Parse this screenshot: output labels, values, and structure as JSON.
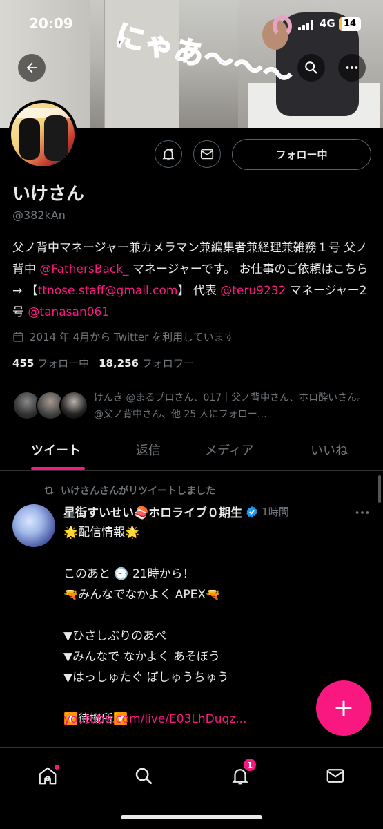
{
  "status_bar": {
    "time": "20:09",
    "network": "4G",
    "battery": "14",
    "battery_level": 0.14
  },
  "banner": {
    "caption": "にゃあ～～～"
  },
  "profile": {
    "name": "いけさん",
    "handle": "@382kAn",
    "follow_button": "フォロー中",
    "bio": {
      "t1": "父ノ背中マネージャー兼カメラマン兼編集者兼経理兼雑務１号 父ノ背中 ",
      "l1": "@FathersBack_",
      "t2": " マネージャーです。 お仕事のご依頼はこちら → 【",
      "l2": "ttnose.staff@gmail.com",
      "t3": "】 代表 ",
      "l3": "@teru9232",
      "t4": " マネージャー2号 ",
      "l4": "@tanasan061"
    },
    "joined": "2014 年 4月から Twitter を利用しています",
    "following_count": "455",
    "following_label": "フォロー中",
    "followers_count": "18,256",
    "followers_label": "フォロワー",
    "known_followers_text": "けんき @まるプロさん、017｜父ノ背中さん、ホロ酔いさん。@父ノ背中さん、他 25 人にフォロー…"
  },
  "tabs": [
    {
      "label": "ツイート",
      "active": true
    },
    {
      "label": "返信",
      "active": false
    },
    {
      "label": "メディア",
      "active": false
    },
    {
      "label": "いいね",
      "active": false
    }
  ],
  "tweet": {
    "retweet_label": "いけさんさんがリツイートしました",
    "display_name": "星街すいせい🍣ホロライブ０期生",
    "time": "1時間",
    "body": "🌟配信情報🌟\n\nこのあと 🕘 21時から！\n🔫みんなでなかよく APEX🔫\n\n▼ひさしぶりのあぺ\n▼みんなで なかよく あそぼう\n▼はっしゅたぐ ぼしゅうちゅう\n\n🔽待機所🔽",
    "link": "youtube.com/live/E03LhDuqz..."
  },
  "bottom_nav": {
    "notifications_badge": "1"
  },
  "colors": {
    "accent": "#f91880",
    "background": "#000000",
    "muted": "#71767b",
    "text": "#e7e9ea"
  }
}
